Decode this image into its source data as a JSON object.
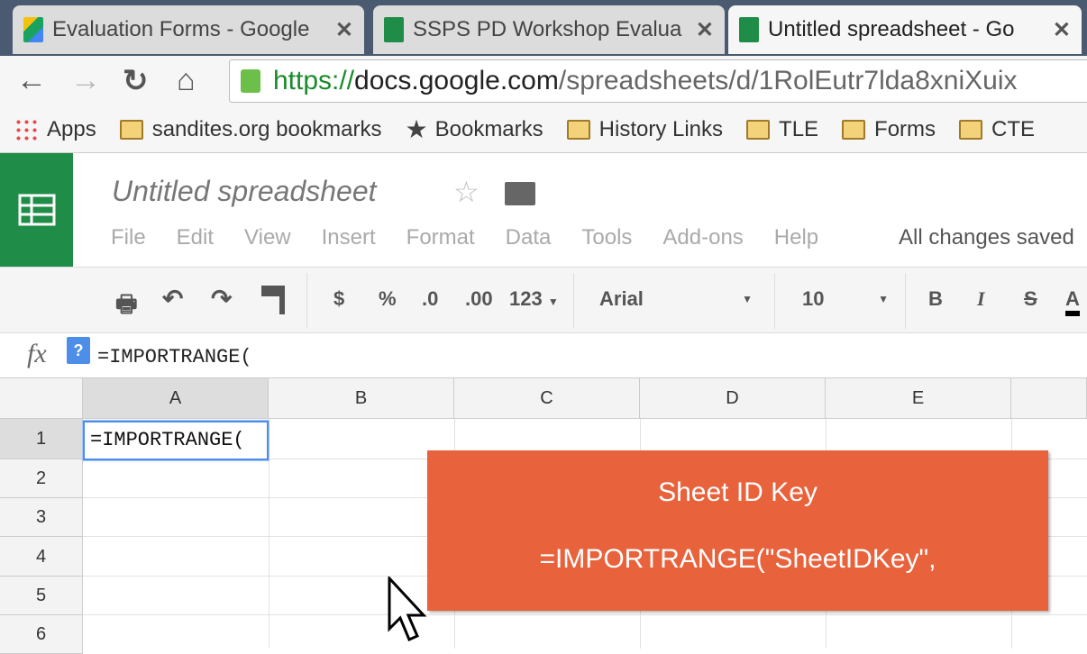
{
  "browser": {
    "tabs": [
      {
        "title": "Evaluation Forms - Google",
        "icon": "google-drive-icon"
      },
      {
        "title": "SSPS PD Workshop Evalua",
        "icon": "sheets-icon"
      },
      {
        "title": "Untitled spreadsheet - Go",
        "icon": "sheets-icon",
        "active": true
      }
    ],
    "url_scheme": "https://",
    "url_host": "docs.google.com",
    "url_path": "/spreadsheets/d/1RolEutr7lda8xniXuix",
    "bookmarks": [
      {
        "label": "Apps",
        "icon": "apps-grid-icon"
      },
      {
        "label": "sandites.org bookmarks",
        "icon": "folder-icon"
      },
      {
        "label": "Bookmarks",
        "icon": "star-icon"
      },
      {
        "label": "History Links",
        "icon": "folder-icon"
      },
      {
        "label": "TLE",
        "icon": "folder-icon"
      },
      {
        "label": "Forms",
        "icon": "folder-icon"
      },
      {
        "label": "CTE",
        "icon": "folder-icon"
      }
    ]
  },
  "app": {
    "title": "Untitled spreadsheet",
    "menus": [
      "File",
      "Edit",
      "View",
      "Insert",
      "Format",
      "Data",
      "Tools",
      "Add-ons",
      "Help"
    ],
    "save_status": "All changes saved",
    "brand_color": "#1f8c47"
  },
  "toolbar": {
    "currency": "$",
    "percent": "%",
    "dec_less": ".0",
    "dec_more": ".00",
    "number_format": "123",
    "font": "Arial",
    "font_size": "10",
    "bold": "B",
    "italic": "I",
    "strike": "S",
    "text_color": "A"
  },
  "formula_bar": {
    "fx": "fx",
    "help": "?",
    "value": "=IMPORTRANGE("
  },
  "grid": {
    "columns": [
      "A",
      "B",
      "C",
      "D",
      "E"
    ],
    "rows": [
      "1",
      "2",
      "3",
      "4",
      "5",
      "6"
    ],
    "active_cell_value": "=IMPORTRANGE("
  },
  "callout": {
    "title": "Sheet ID Key",
    "formula": "=IMPORTRANGE(\"SheetIDKey\",",
    "color": "#e8623c"
  }
}
